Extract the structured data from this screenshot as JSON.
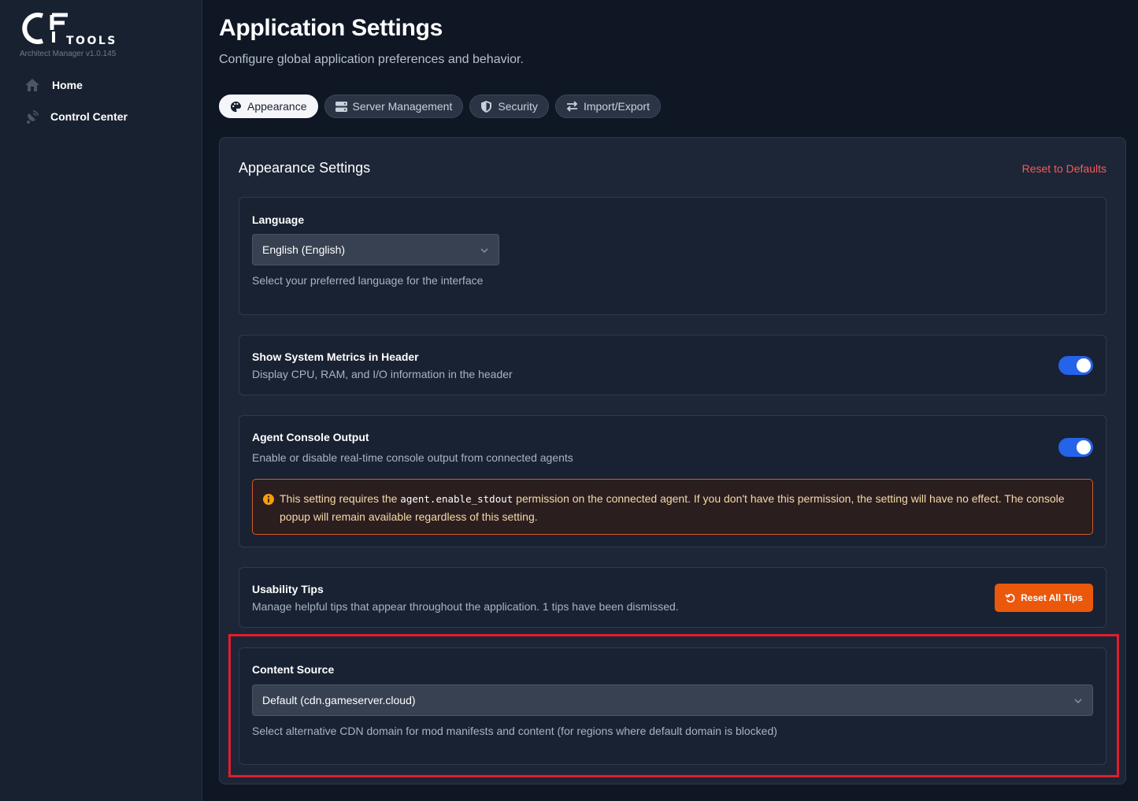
{
  "app": {
    "logo_text": "TOOLS",
    "version": "Architect Manager v1.0.145"
  },
  "sidebar": {
    "items": [
      {
        "label": "Home",
        "icon": "home-icon"
      },
      {
        "label": "Control Center",
        "icon": "satellite-icon"
      }
    ]
  },
  "header": {
    "title": "Application Settings",
    "subtitle": "Configure global application preferences and behavior."
  },
  "tabs": [
    {
      "label": "Appearance",
      "icon": "palette-icon",
      "active": true
    },
    {
      "label": "Server Management",
      "icon": "server-icon",
      "active": false
    },
    {
      "label": "Security",
      "icon": "shield-icon",
      "active": false
    },
    {
      "label": "Import/Export",
      "icon": "swap-arrows-icon",
      "active": false
    }
  ],
  "panel": {
    "title": "Appearance Settings",
    "reset_label": "Reset to Defaults"
  },
  "language": {
    "title": "Language",
    "selected": "English (English)",
    "description": "Select your preferred language for the interface"
  },
  "metrics": {
    "title": "Show System Metrics in Header",
    "description": "Display CPU, RAM, and I/O information in the header",
    "enabled": true
  },
  "console": {
    "title": "Agent Console Output",
    "description": "Enable or disable real-time console output from connected agents",
    "enabled": true,
    "warning_before": "This setting requires the ",
    "warning_code": "agent.enable_stdout",
    "warning_after": " permission on the connected agent. If you don't have this permission, the setting will have no effect. The console popup will remain available regardless of this setting."
  },
  "tips": {
    "title": "Usability Tips",
    "description": "Manage helpful tips that appear throughout the application. 1 tips have been dismissed.",
    "button_label": "Reset All Tips"
  },
  "content_source": {
    "title": "Content Source",
    "selected": "Default (cdn.gameserver.cloud)",
    "description": "Select alternative CDN domain for mod manifests and content (for regions where default domain is blocked)"
  },
  "colors": {
    "accent_blue": "#2563eb",
    "accent_orange": "#ea580c",
    "danger_red": "#f25b5b",
    "highlight_red": "#e11d2e"
  }
}
